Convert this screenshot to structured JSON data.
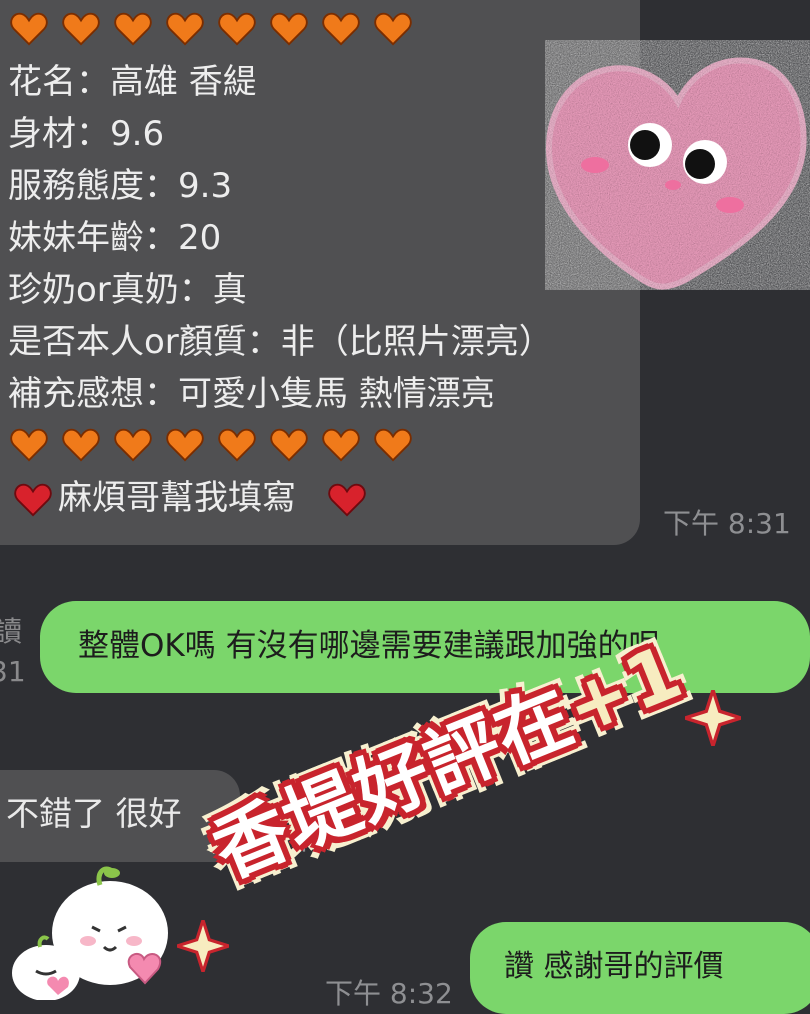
{
  "incoming_message": {
    "lines": [
      "花名：高雄 香緹",
      "身材：9.6",
      "服務態度：9.3",
      "妹妹年齡：20",
      "珍奶or真奶：真",
      "是否本人or顏質：非（比照片漂亮）",
      "補充感想：可愛小隻馬 熱情漂亮"
    ],
    "footer": "麻煩哥幫我填寫",
    "time": "下午 8:31"
  },
  "outgoing_question": {
    "text": "整體OK嗎 有沒有哪邊需要建議跟加強的呢"
  },
  "left_edge": {
    "label1": "讀",
    "label2": "31"
  },
  "incoming_reply": {
    "text": "不錯了 很好",
    "time_partial": "下午"
  },
  "outgoing_thanks": {
    "text": "讚 感謝哥的評價",
    "time": "下午 8:32"
  },
  "stamp": {
    "text": "香堤好評在",
    "plus": "+1"
  },
  "colors": {
    "background": "#2e2f33",
    "gray_bubble": "#505052",
    "green_bubble": "#7bd66b",
    "orange_heart": "#f07a1a",
    "red_heart": "#d8222c",
    "sticker_pink": "#f4a3c4",
    "stamp_red": "#c8242d"
  },
  "icons": {
    "heart_row": "orange-heart-icon",
    "footer_heart": "red-heart-icon",
    "sticker": "pink-heart-face-sticker",
    "character": "bun-character-sticker"
  }
}
